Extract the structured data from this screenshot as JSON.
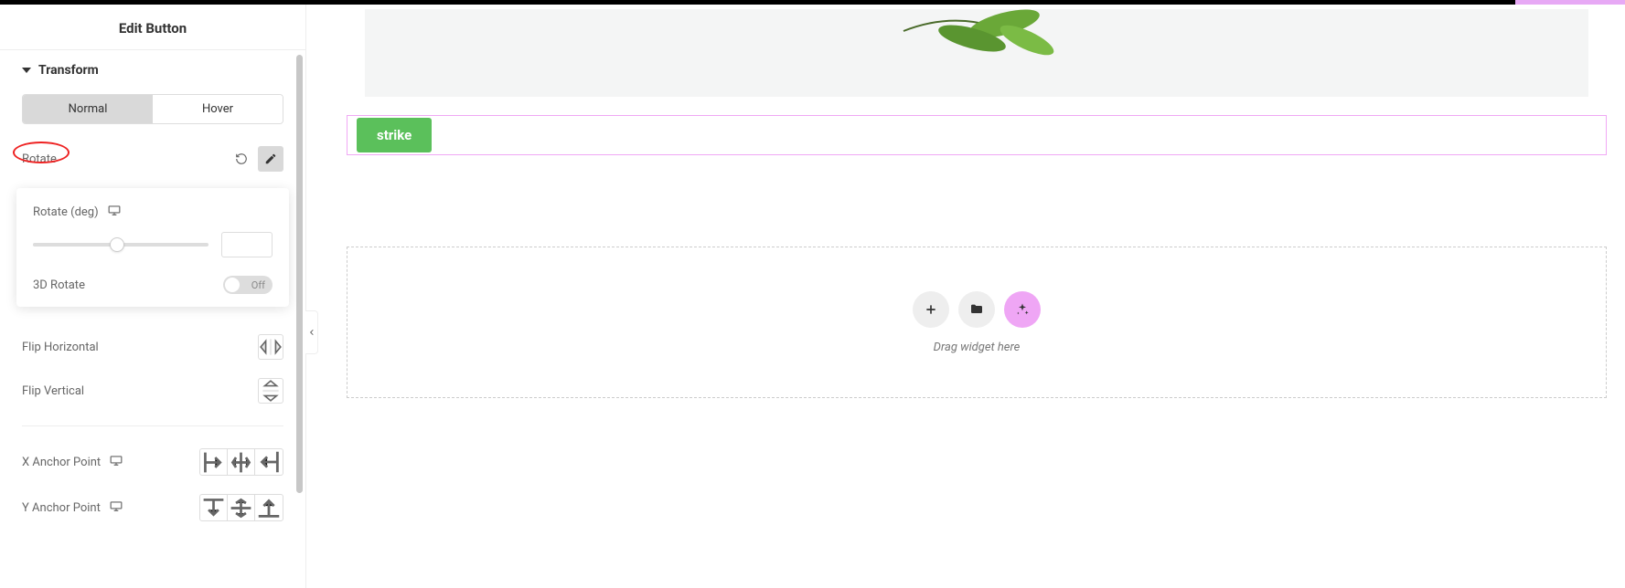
{
  "panel": {
    "title": "Edit Button",
    "section": "Transform",
    "tabs": {
      "normal": "Normal",
      "hover": "Hover"
    },
    "rotate": {
      "label": "Rotate",
      "deg_label": "Rotate (deg)",
      "three_d_label": "3D Rotate",
      "three_d_state": "Off"
    },
    "flip_h": "Flip Horizontal",
    "flip_v": "Flip Vertical",
    "x_anchor": "X Anchor Point",
    "y_anchor": "Y Anchor Point"
  },
  "canvas": {
    "button_label": "strike",
    "dropzone_text": "Drag widget here"
  }
}
